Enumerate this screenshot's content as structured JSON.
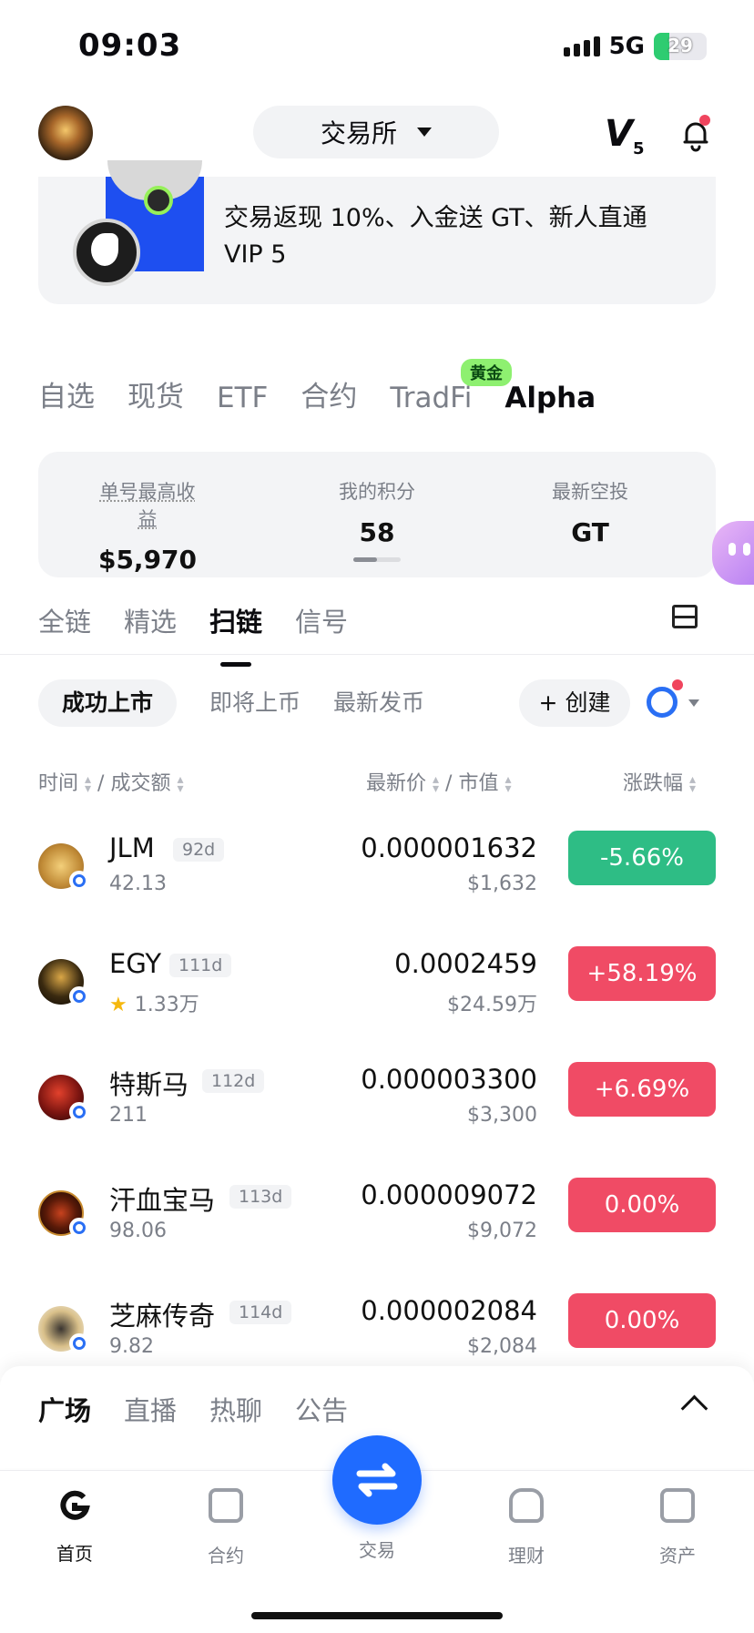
{
  "status_bar": {
    "time": "09:03",
    "network": "5G",
    "battery": "29"
  },
  "header": {
    "exchange_label": "交易所",
    "vip_level": "V",
    "vip_num": "5"
  },
  "banner": {
    "text": "交易返现 10%、入金送 GT、新人直通 VIP 5"
  },
  "categories": {
    "items": [
      "自选",
      "现货",
      "ETF",
      "合约",
      "TradFi",
      "Alpha"
    ],
    "badge": "黄金"
  },
  "stats": {
    "max_profit_label": "单号最高收益",
    "max_profit_value": "$5,970",
    "points_label": "我的积分",
    "points_value": "58",
    "airdrop_label": "最新空投",
    "airdrop_value": "GT"
  },
  "chains": {
    "items": [
      "全链",
      "精选",
      "扫链",
      "信号"
    ]
  },
  "filters": {
    "active": "成功上市",
    "upcoming": "即将上币",
    "latest": "最新发币",
    "create": "+ 创建"
  },
  "columns": {
    "time": "时间",
    "volume": "成交额",
    "price": "最新价",
    "mcap": "市值",
    "change": "涨跌幅"
  },
  "tokens": [
    {
      "name": "JLM",
      "age": "92d",
      "volume": "42.13",
      "price": "0.000001632",
      "mcap": "$1,632",
      "change": "-5.66%"
    },
    {
      "name": "EGY",
      "age": "111d",
      "volume": "1.33万",
      "price": "0.0002459",
      "mcap": "$24.59万",
      "change": "+58.19%"
    },
    {
      "name": "特斯马",
      "age": "112d",
      "volume": "211",
      "price": "0.000003300",
      "mcap": "$3,300",
      "change": "+6.69%"
    },
    {
      "name": "汗血宝马",
      "age": "113d",
      "volume": "98.06",
      "price": "0.000009072",
      "mcap": "$9,072",
      "change": "0.00%"
    },
    {
      "name": "芝麻传奇",
      "age": "114d",
      "volume": "9.82",
      "price": "0.000002084",
      "mcap": "$2,084",
      "change": "0.00%"
    }
  ],
  "sheet": {
    "tabs": [
      "广场",
      "直播",
      "热聊",
      "公告"
    ]
  },
  "tabbar": {
    "home": "首页",
    "futures": "合约",
    "trade": "交易",
    "finance": "理财",
    "assets": "资产"
  },
  "colors": {
    "accent": "#1f6bff",
    "up": "#f04b65",
    "down": "#2ebd85"
  }
}
